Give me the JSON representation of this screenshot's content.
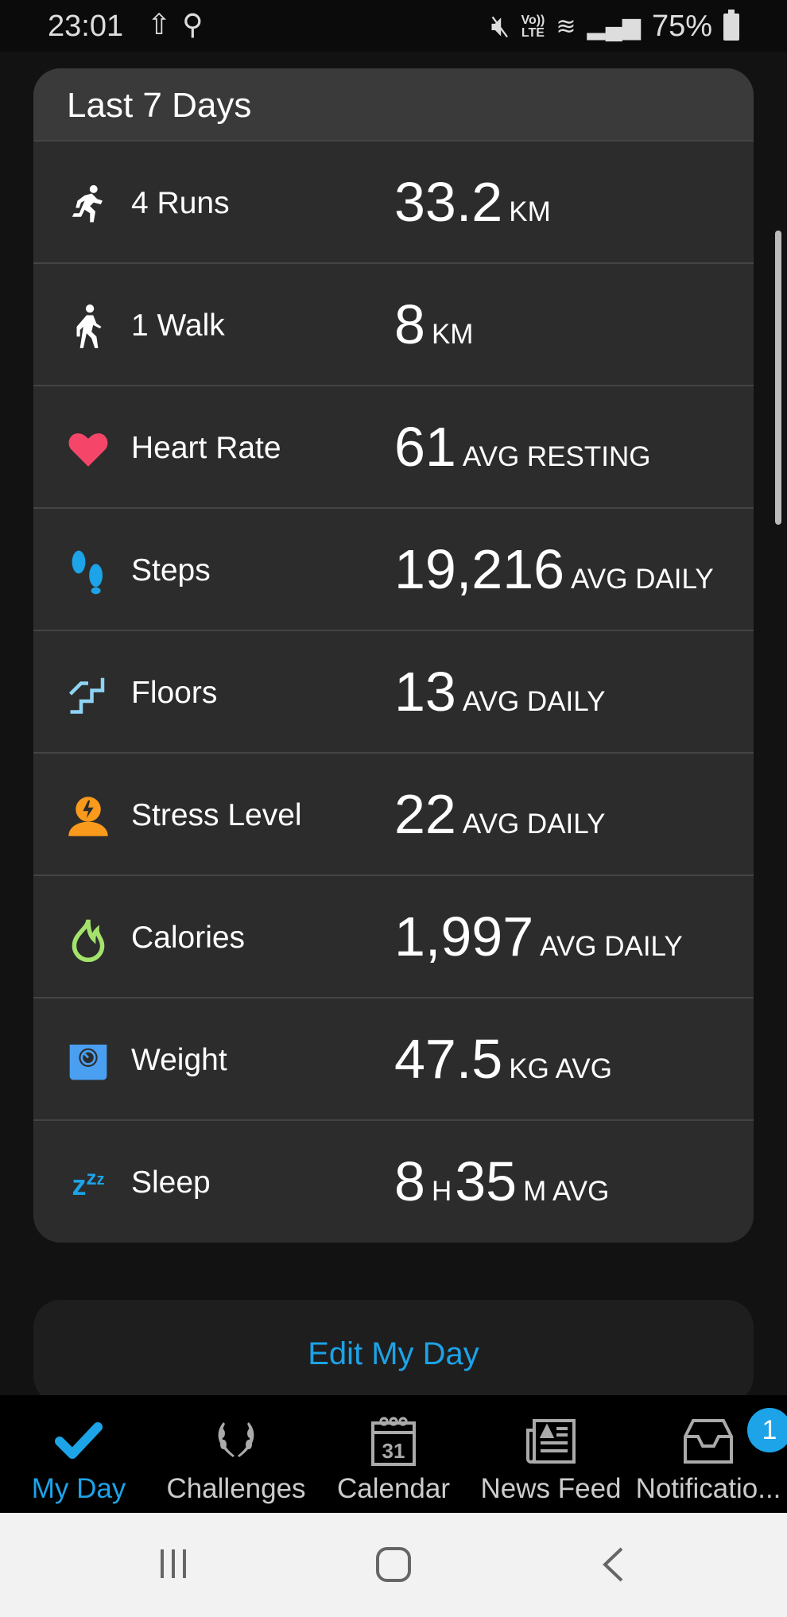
{
  "status_bar": {
    "time": "23:01",
    "battery": "75%",
    "network": "LTE"
  },
  "card": {
    "title": "Last 7 Days",
    "rows": [
      {
        "icon": "running-icon",
        "label": "4 Runs",
        "parts": [
          [
            "33.2",
            "KM"
          ]
        ],
        "color": "#ffffff"
      },
      {
        "icon": "walking-icon",
        "label": "1 Walk",
        "parts": [
          [
            "8",
            "KM"
          ]
        ],
        "color": "#ffffff"
      },
      {
        "icon": "heart-icon",
        "label": "Heart Rate",
        "parts": [
          [
            "61",
            "AVG RESTING"
          ]
        ],
        "color": "#f5466a"
      },
      {
        "icon": "footsteps-icon",
        "label": "Steps",
        "parts": [
          [
            "19,216",
            "AVG DAILY"
          ]
        ],
        "color": "#1ca3e8"
      },
      {
        "icon": "stairs-icon",
        "label": "Floors",
        "parts": [
          [
            "13",
            "AVG DAILY"
          ]
        ],
        "color": "#8fd3f4"
      },
      {
        "icon": "stress-icon",
        "label": "Stress Level",
        "parts": [
          [
            "22",
            "AVG DAILY"
          ]
        ],
        "color": "#f99a1c"
      },
      {
        "icon": "flame-icon",
        "label": "Calories",
        "parts": [
          [
            "1,997",
            "AVG DAILY"
          ]
        ],
        "color": "#a3e36b"
      },
      {
        "icon": "scale-icon",
        "label": "Weight",
        "parts": [
          [
            "47.5",
            "KG AVG"
          ]
        ],
        "color": "#4a9ff0"
      },
      {
        "icon": "sleep-icon",
        "label": "Sleep",
        "parts": [
          [
            "8",
            "H"
          ],
          [
            "35",
            "M AVG"
          ]
        ],
        "color": "#1ca3e8"
      }
    ]
  },
  "edit_button": "Edit My Day",
  "tabs": [
    {
      "label": "My Day",
      "icon": "checkmark-icon",
      "active": true
    },
    {
      "label": "Challenges",
      "icon": "laurel-icon"
    },
    {
      "label": "Calendar",
      "icon": "calendar-icon",
      "day": "31"
    },
    {
      "label": "News Feed",
      "icon": "newspaper-icon"
    },
    {
      "label": "Notificatio...",
      "icon": "inbox-icon",
      "badge": "1"
    }
  ],
  "accent": "#1ca3e8"
}
